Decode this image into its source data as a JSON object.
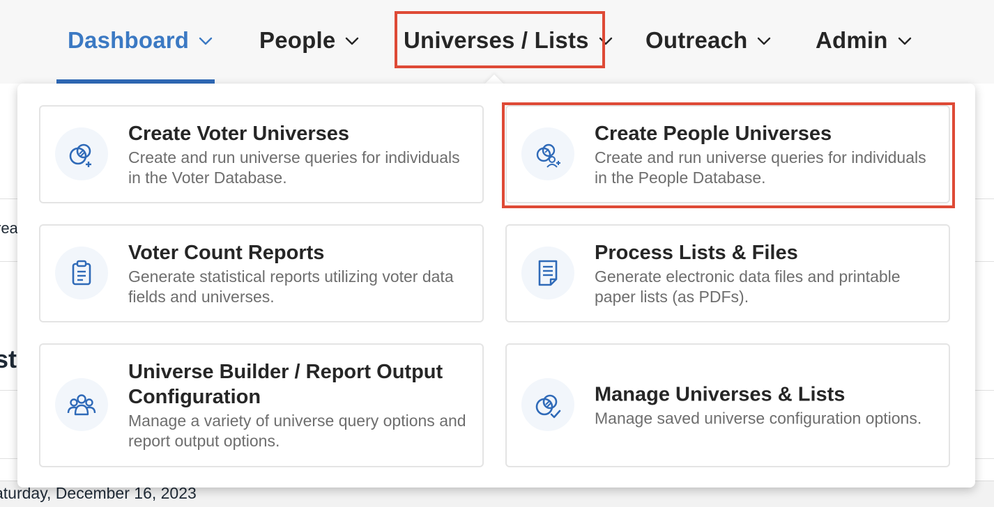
{
  "nav": {
    "items": [
      {
        "label": "Dashboard",
        "active": true
      },
      {
        "label": "People",
        "active": false
      },
      {
        "label": "Universes / Lists",
        "active": false,
        "highlighted": true
      },
      {
        "label": "Outreach",
        "active": false
      },
      {
        "label": "Admin",
        "active": false
      }
    ]
  },
  "background": {
    "fragment_1": "rea",
    "fragment_2": "st",
    "date": "aturday, December 16, 2023"
  },
  "dropdown": {
    "cards": [
      {
        "title": "Create Voter Universes",
        "desc": "Create and run universe queries for individuals in the Voter Database.",
        "icon": "voter-universe-icon"
      },
      {
        "title": "Create People Universes",
        "desc": "Create and run universe queries for individuals in the People Database.",
        "icon": "people-universe-icon",
        "highlighted": true
      },
      {
        "title": "Voter Count Reports",
        "desc": "Generate statistical reports utilizing voter data fields and universes.",
        "icon": "clipboard-icon"
      },
      {
        "title": "Process Lists & Files",
        "desc": "Generate electronic data files and printable paper lists (as PDFs).",
        "icon": "document-icon"
      },
      {
        "title": "Universe Builder / Report Output Configuration",
        "desc": "Manage a variety of universe query options and report output options.",
        "icon": "group-icon"
      },
      {
        "title": "Manage Universes & Lists",
        "desc": "Manage saved universe configuration options.",
        "icon": "manage-universe-icon"
      }
    ]
  },
  "colors": {
    "accent": "#3b79c3",
    "highlight": "#de4a36",
    "icon": "#2f6ab8"
  }
}
